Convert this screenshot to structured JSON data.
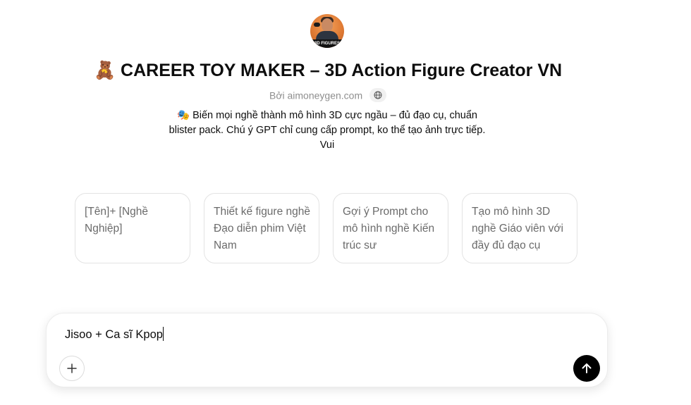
{
  "gpt": {
    "avatar_label": "3D FIGURES",
    "title_emoji": "🧸",
    "title": "CAREER TOY MAKER – 3D Action Figure Creator VN",
    "byline": "Bởi aimoneygen.com",
    "description_emoji": "🎭",
    "description": "Biến mọi nghề thành mô hình 3D cực ngầu – đủ đạo cụ, chuẩn blister pack. Chú ý GPT chỉ cung cấp prompt, ko thể tạo ảnh trực tiếp. Vui"
  },
  "conversation_starters": [
    "[Tên]+ [Nghề Nghiệp]",
    "Thiết kế figure nghề Đạo diễn phim Việt Nam",
    "Gợi ý Prompt cho mô hình nghề Kiến trúc sư",
    "Tạo mô hình 3D nghề Giáo viên với đầy đủ đạo cụ"
  ],
  "composer": {
    "value": "Jisoo + Ca sĩ Kpop"
  },
  "icons": {
    "globe": "globe-icon",
    "plus": "plus-icon",
    "send": "arrow-up-icon"
  }
}
